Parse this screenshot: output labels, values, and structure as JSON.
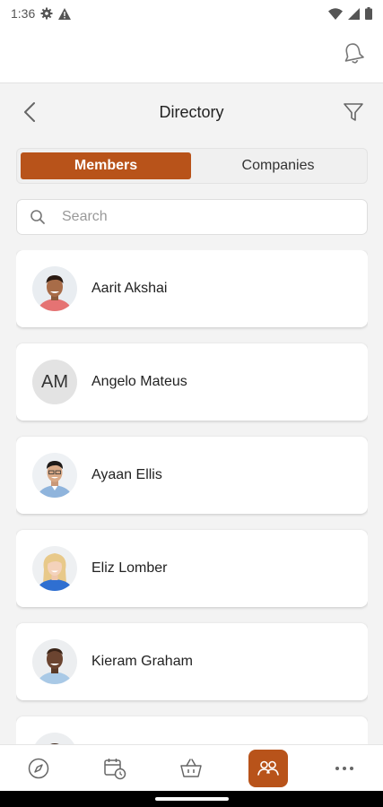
{
  "status_bar": {
    "time": "1:36"
  },
  "header": {
    "title": "Directory"
  },
  "tabs": [
    {
      "label": "Members",
      "active": true
    },
    {
      "label": "Companies",
      "active": false
    }
  ],
  "search": {
    "placeholder": "Search",
    "value": ""
  },
  "members": [
    {
      "name": "Aarit Akshai",
      "avatar": "photo"
    },
    {
      "name": "Angelo Mateus",
      "avatar": "initials",
      "initials": "AM"
    },
    {
      "name": "Ayaan Ellis",
      "avatar": "photo"
    },
    {
      "name": "Eliz Lomber",
      "avatar": "photo"
    },
    {
      "name": "Kieram Graham",
      "avatar": "photo"
    }
  ],
  "bottom_nav": [
    {
      "icon": "compass-icon"
    },
    {
      "icon": "calendar-clock-icon"
    },
    {
      "icon": "basket-icon"
    },
    {
      "icon": "people-icon",
      "active": true
    },
    {
      "icon": "more-icon"
    }
  ],
  "colors": {
    "accent": "#b8531a",
    "background": "#f3f3f3"
  }
}
